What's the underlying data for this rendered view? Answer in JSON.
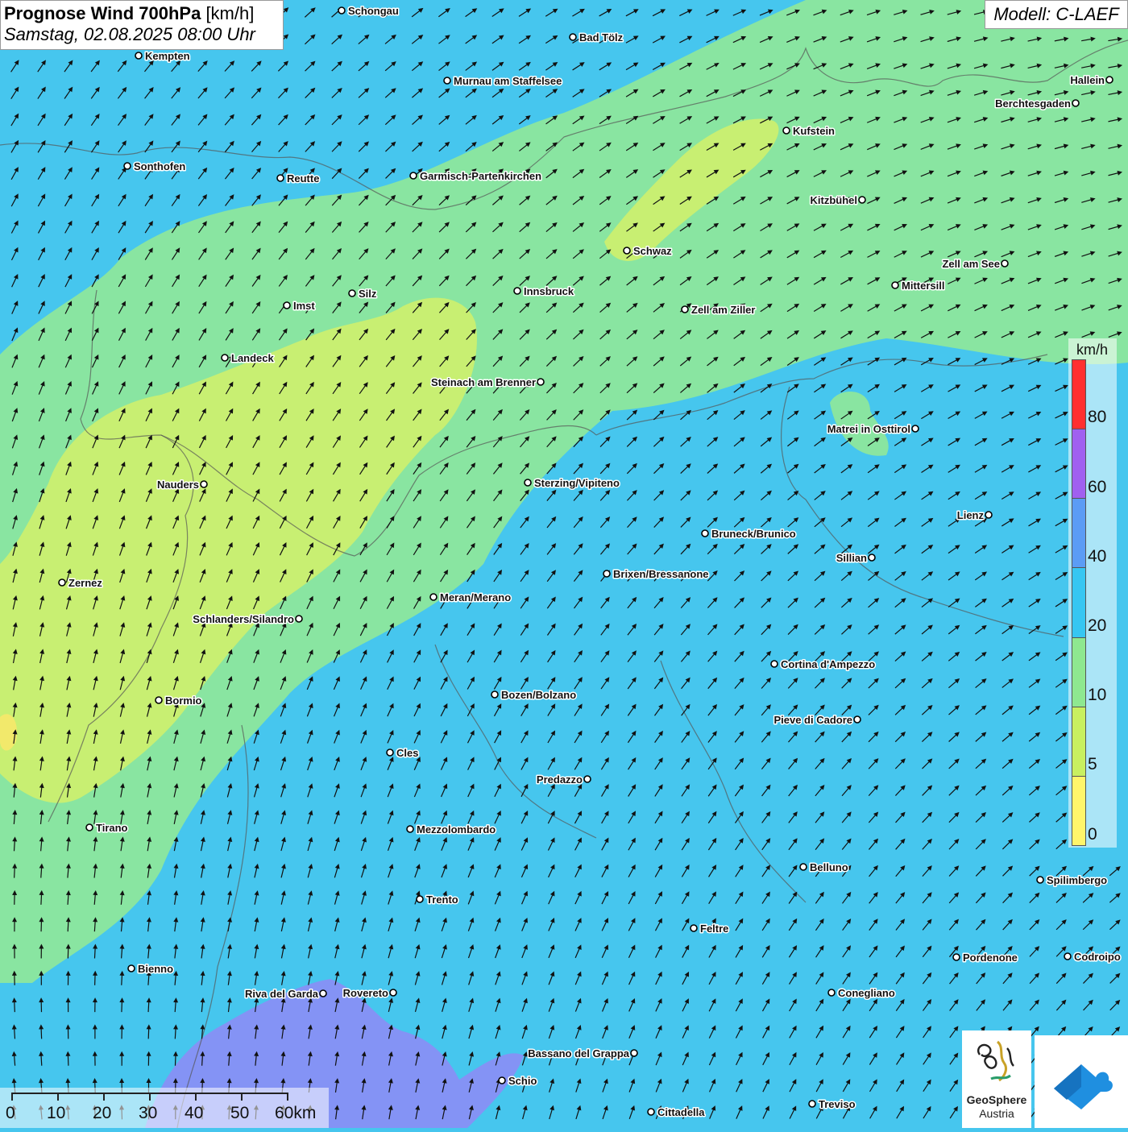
{
  "header": {
    "title_bold": "Prognose Wind 700hPa",
    "title_unit": "[km/h]",
    "subtitle": "Samstag, 02.08.2025 08:00 Uhr"
  },
  "model": {
    "label": "Modell: C-LAEF"
  },
  "legend": {
    "unit": "km/h",
    "labels": [
      "80",
      "60",
      "40",
      "20",
      "10",
      "5",
      "0"
    ],
    "colors": [
      "#ff3030",
      "#a060f0",
      "#5b9cf5",
      "#36c6f2",
      "#8ee890",
      "#c8f060",
      "#fff56a"
    ]
  },
  "scalebar": {
    "labels": [
      "0",
      "10",
      "20",
      "30",
      "40",
      "50",
      "60km"
    ]
  },
  "logos": {
    "geosphere_name": "GeoSphere",
    "geosphere_sub": "Austria"
  },
  "wind": {
    "color_zones": [
      "#46c6ee",
      "#8fe79a",
      "#cdf06e",
      "#f5e86a",
      "#8a8ef5"
    ]
  },
  "cities": [
    "Schongau",
    "Bad Tölz",
    "Kempten",
    "Murnau am Staffelsee",
    "Hallein",
    "Berchtesgaden",
    "Kufstein",
    "Sonthofen",
    "Reutte",
    "Garmisch-Partenkirchen",
    "Kitzbühel",
    "Schwaz",
    "Zell am See",
    "Mittersill",
    "Silz",
    "Innsbruck",
    "Imst",
    "Zell am Ziller",
    "Landeck",
    "Steinach am Brenner",
    "Matrei in Osttirol",
    "Nauders",
    "Sterzing/Vipiteno",
    "Lienz",
    "Bruneck/Brunico",
    "Sillian",
    "Brixen/Bressanone",
    "Zernez",
    "Meran/Merano",
    "Schlanders/Silandro",
    "Cortina d'Ampezzo",
    "Bozen/Bolzano",
    "Bormio",
    "Pieve di Cadore",
    "Cles",
    "Predazzo",
    "Tirano",
    "Mezzolombardo",
    "Belluno",
    "Spilimbergo",
    "Trento",
    "Feltre",
    "Pordenone",
    "Codroipo",
    "Bienno",
    "Riva del Garda",
    "Rovereto",
    "Conegliano",
    "Bassano del Grappa",
    "Schio",
    "Treviso",
    "Cittadella"
  ]
}
